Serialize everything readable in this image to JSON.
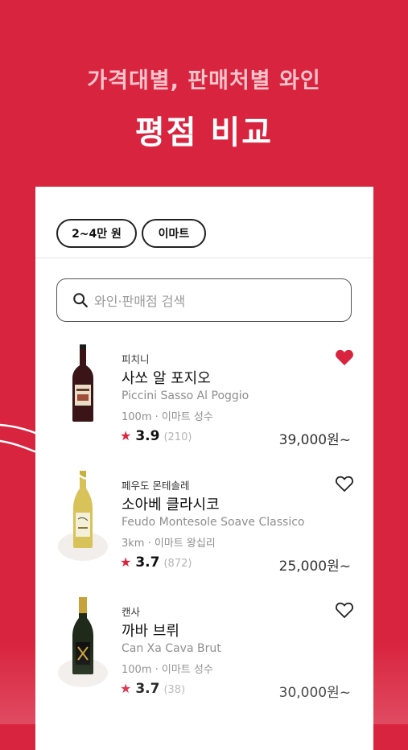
{
  "headline": "가격대별, 판매처별 와인",
  "title": "평점 비교",
  "filters": {
    "price_chip": "2~4만 원",
    "store_chip": "이마트"
  },
  "search": {
    "placeholder": "와인·판매점 검색"
  },
  "items": [
    {
      "producer": "피치니",
      "name": "사쏘 알 포지오",
      "en_name": "Piccini Sasso Al Poggio",
      "meta": "100m · 이마트 성수",
      "score": "3.9",
      "count": "(210)",
      "price": "39,000원~",
      "liked": true,
      "bottle": "red-wine"
    },
    {
      "producer": "페우도 몬테솔레",
      "name": "소아베 클라시코",
      "en_name": "Feudo Montesole Soave Classico",
      "meta": "3km · 이마트 왕십리",
      "score": "3.7",
      "count": "(872)",
      "price": "25,000원~",
      "liked": false,
      "bottle": "white-wine"
    },
    {
      "producer": "캔사",
      "name": "까바 브뤼",
      "en_name": "Can Xa Cava Brut",
      "meta": "100m · 이마트 성수",
      "score": "3.7",
      "count": "(38)",
      "price": "30,000원~",
      "liked": false,
      "bottle": "sparkling-wine"
    }
  ],
  "colors": {
    "brand": "#D9243F",
    "chip_border": "#222222",
    "muted_text": "#8E8E8E"
  },
  "icons": {
    "search": "search-icon",
    "heart_filled": "heart-filled-icon",
    "heart_outline": "heart-outline-icon",
    "star": "star-icon"
  }
}
